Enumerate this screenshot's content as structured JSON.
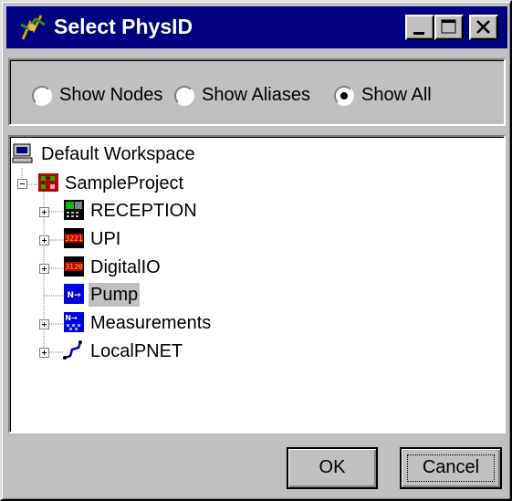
{
  "window": {
    "title": "Select PhysID"
  },
  "titlebar_buttons": {
    "minimize": "minimize",
    "maximize": "maximize",
    "close": "close"
  },
  "radio_group": {
    "options": [
      {
        "label": "Show Nodes",
        "selected": false
      },
      {
        "label": "Show Aliases",
        "selected": false
      },
      {
        "label": "Show All",
        "selected": true
      }
    ]
  },
  "tree": {
    "root": {
      "label": "Default Workspace",
      "icon": "computer-icon"
    },
    "project": {
      "label": "SampleProject",
      "icon": "project-icon",
      "expanded": true
    },
    "children": [
      {
        "label": "RECEPTION",
        "icon": "reception-icon",
        "expandable": true
      },
      {
        "label": "UPI",
        "icon": "upi-device-icon",
        "icon_text": "3221",
        "expandable": true
      },
      {
        "label": "DigitalIO",
        "icon": "digitalio-device-icon",
        "icon_text": "3120",
        "expandable": true
      },
      {
        "label": "Pump",
        "icon": "pump-icon",
        "icon_text": "N→",
        "expandable": false,
        "selected": true
      },
      {
        "label": "Measurements",
        "icon": "measurements-icon",
        "icon_text": "N→",
        "expandable": true
      },
      {
        "label": "LocalPNET",
        "icon": "network-icon",
        "expandable": true
      }
    ]
  },
  "buttons": {
    "ok": "OK",
    "cancel": "Cancel"
  }
}
